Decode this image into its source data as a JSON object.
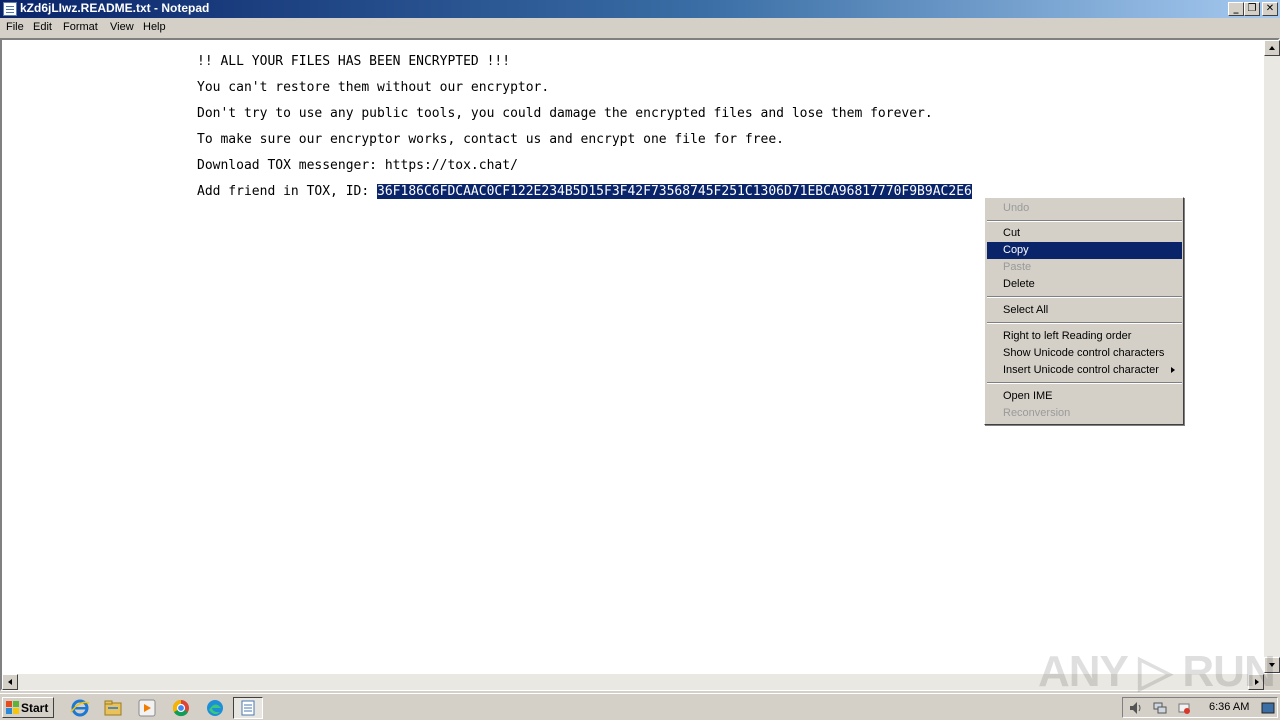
{
  "window": {
    "title": "kZd6jLIwz.README.txt - Notepad",
    "minimize_glyph": "_",
    "maximize_glyph": "❐",
    "close_glyph": "✕"
  },
  "menu": {
    "file": "File",
    "edit": "Edit",
    "format": "Format",
    "view": "View",
    "help": "Help"
  },
  "document": {
    "line1": "!! ALL YOUR FILES HAS BEEN ENCRYPTED !!!",
    "line2": "You can't restore them without our encryptor.",
    "line3": "Don't try to use any public tools, you could damage the encrypted files and lose them forever.",
    "line4": "To make sure our encryptor works, contact us and encrypt one file for free.",
    "line5": "Download TOX messenger: https://tox.chat/",
    "line6_prefix": "Add friend in TOX, ID: ",
    "line6_selected": "36F186C6FDCAAC0CF122E234B5D15F3F42F73568745F251C1306D71EBCA96817770F9B9AC2E6"
  },
  "context_menu": {
    "undo": "Undo",
    "cut": "Cut",
    "copy": "Copy",
    "paste": "Paste",
    "delete": "Delete",
    "select_all": "Select All",
    "rtl": "Right to left Reading order",
    "show_unicode": "Show Unicode control characters",
    "insert_unicode": "Insert Unicode control character",
    "open_ime": "Open IME",
    "reconversion": "Reconversion"
  },
  "watermark": "ANY ▷ RUN",
  "taskbar": {
    "start": "Start",
    "clock": "6:36 AM",
    "icons": [
      "ie-icon",
      "explorer-icon",
      "media-player-icon",
      "chrome-icon",
      "edge-icon",
      "notepad-icon"
    ]
  }
}
